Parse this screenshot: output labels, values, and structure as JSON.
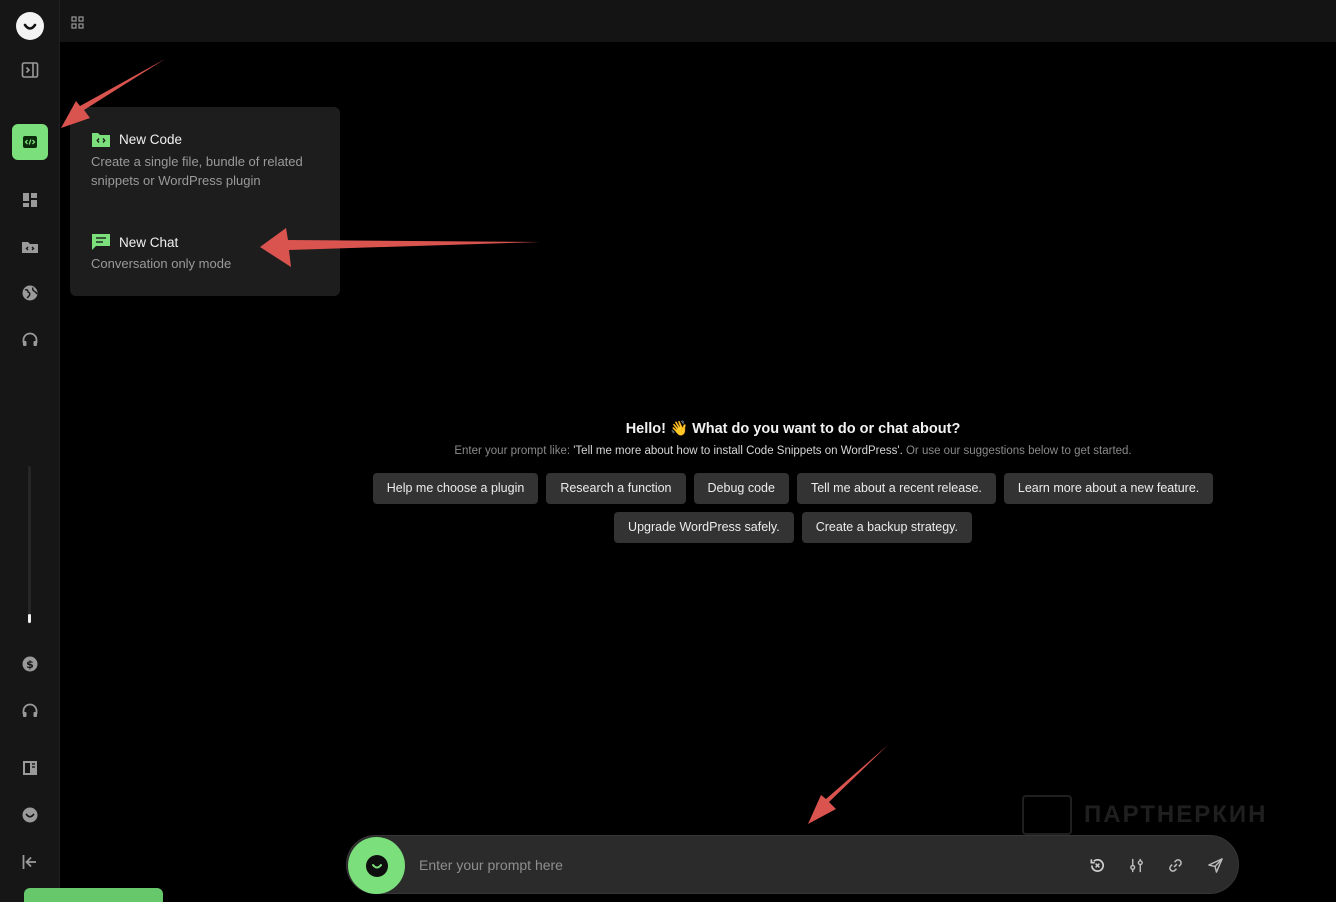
{
  "sidebar": {
    "logo_icon": "smile-logo-icon",
    "items": [
      {
        "name": "panel-toggle",
        "icon": "panel-right-icon"
      },
      {
        "name": "new-code",
        "icon": "code-icon",
        "active": true
      },
      {
        "name": "dashboard",
        "icon": "dashboard-icon"
      },
      {
        "name": "code-folder",
        "icon": "code-folder-icon"
      },
      {
        "name": "globe",
        "icon": "globe-icon"
      },
      {
        "name": "support",
        "icon": "headphones-icon"
      },
      {
        "name": "billing",
        "icon": "dollar-icon"
      },
      {
        "name": "support-2",
        "icon": "headphones-icon"
      },
      {
        "name": "docs",
        "icon": "book-icon"
      },
      {
        "name": "profile",
        "icon": "smile-icon"
      },
      {
        "name": "collapse",
        "icon": "collapse-left-icon"
      }
    ]
  },
  "topbar": {
    "grid_icon": "grid-icon"
  },
  "menu": {
    "new_code": {
      "title": "New Code",
      "desc": "Create a single file, bundle of related snippets or WordPress plugin"
    },
    "new_chat": {
      "title": "New Chat",
      "desc": "Conversation only mode"
    }
  },
  "welcome": {
    "hello": "Hello! 👋 What do you want to do or chat about?",
    "hint_prefix": "Enter your prompt like: ",
    "hint_example": "'Tell me more about how to install Code Snippets on WordPress'.",
    "hint_suffix": " Or use our suggestions below to get started."
  },
  "suggestions": [
    "Help me choose a plugin",
    "Research a function",
    "Debug code",
    "Tell me about a recent release.",
    "Learn more about a new feature.",
    "Upgrade WordPress safely.",
    "Create a backup strategy."
  ],
  "prompt": {
    "placeholder": "Enter your prompt here"
  },
  "watermark": {
    "text": "ПАРТНЕРКИН"
  },
  "colors": {
    "accent": "#7be07b",
    "background": "#000000",
    "sidebar": "#161616",
    "chip": "#333333",
    "annotation_arrow": "#d9534f"
  }
}
